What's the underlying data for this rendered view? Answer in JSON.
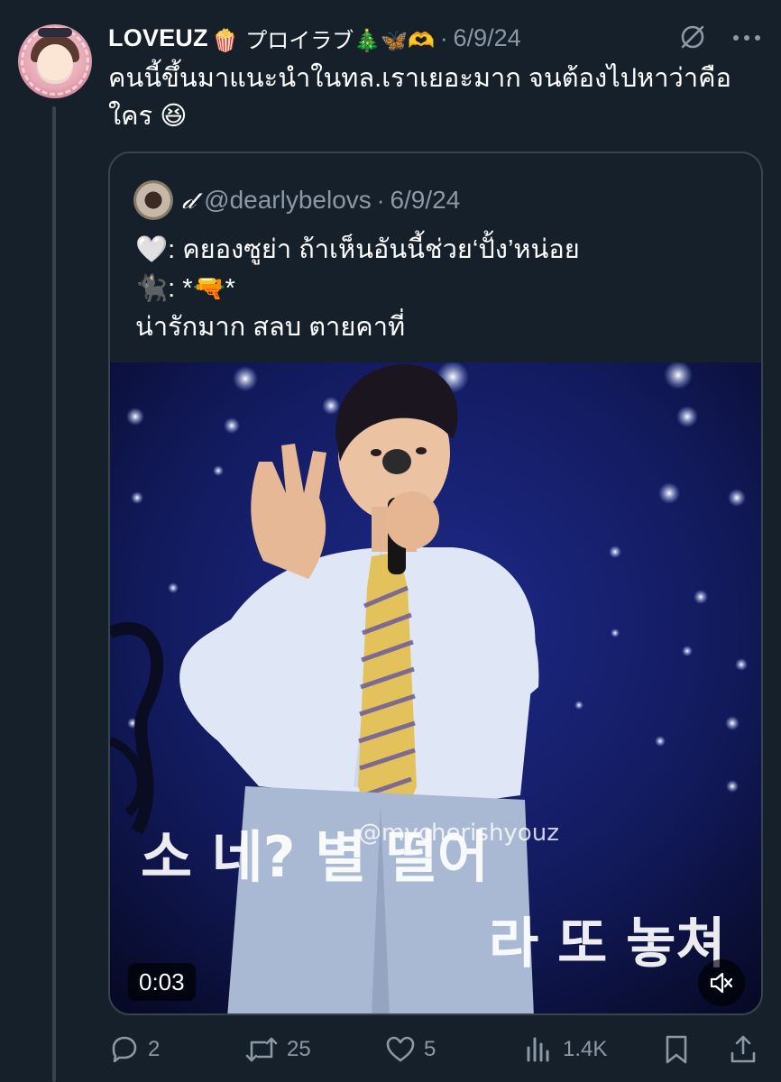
{
  "post": {
    "author_name": "LOVEUZ",
    "author_emojis": "🍿 プロイラブ🎄🦋🫶",
    "date": "6/9/24",
    "text": "คนนี้ขึ้นมาแนะนำในทล.เราเยอะมาก จนต้องไปหาว่าคือใคร 😆"
  },
  "quote": {
    "display_name": "𝒹",
    "handle": "@dearlybelovs",
    "date": "6/9/24",
    "lines": [
      "🤍: คยองซูย่า ถ้าเห็นอันนี้ช่วย‘ปั้ง’หน่อย",
      "🐈‍⬛: *🔫*",
      "น่ารักมาก สลบ ตายคาที่"
    ],
    "video": {
      "timestamp": "0:03",
      "watermark": "@mycherishyouz",
      "caption_line1": "소      네? 별 떨어",
      "caption_line2": "라 또 놓쳐"
    }
  },
  "actions": {
    "replies": "2",
    "reposts": "25",
    "likes": "5",
    "views": "1.4K"
  },
  "colors": {
    "background": "#15202b",
    "secondary_text": "#8b98a5",
    "border": "#38444d"
  },
  "icons": [
    "grok-icon",
    "more-icon",
    "reply-icon",
    "repost-icon",
    "like-icon",
    "views-icon",
    "bookmark-icon",
    "share-icon",
    "mute-icon"
  ]
}
